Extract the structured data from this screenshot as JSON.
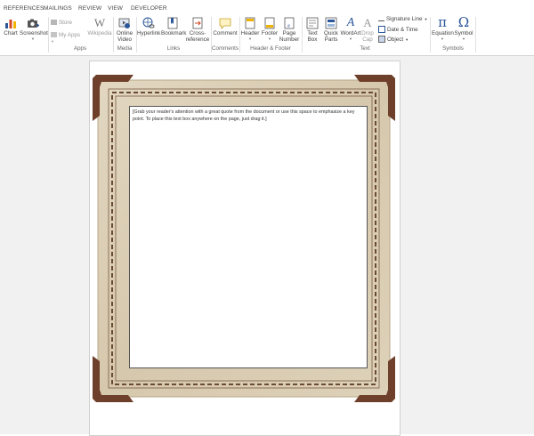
{
  "tabs": [
    "REFERENCES",
    "MAILINGS",
    "REVIEW",
    "VIEW",
    "DEVELOPER"
  ],
  "ribbon": {
    "chart_label": "Chart",
    "screenshot_label": "Screenshot",
    "store_label": "Store",
    "myapps_label": "My Apps",
    "wikipedia_label": "Wikipedia",
    "online_video_label_1": "Online",
    "online_video_label_2": "Video",
    "hyperlink_label": "Hyperlink",
    "bookmark_label": "Bookmark",
    "crossref_label_1": "Cross-",
    "crossref_label_2": "reference",
    "comment_label": "Comment",
    "header_label": "Header",
    "footer_label": "Footer",
    "page_number_label_1": "Page",
    "page_number_label_2": "Number",
    "textbox_label_1": "Text",
    "textbox_label_2": "Box",
    "quickparts_label_1": "Quick",
    "quickparts_label_2": "Parts",
    "wordart_label": "WordArt",
    "dropcap_label_1": "Drop",
    "dropcap_label_2": "Cap",
    "signature_line_label": "Signature Line",
    "date_time_label": "Date & Time",
    "object_label": "Object",
    "equation_label": "Equation",
    "symbol_label": "Symbol",
    "wikipedia_glyph": "W",
    "pi_glyph": "π",
    "omega_glyph": "Ω",
    "wordart_glyph": "A",
    "dropcap_glyph": "A"
  },
  "groups": {
    "apps": "Apps",
    "media": "Media",
    "links": "Links",
    "comments": "Comments",
    "header_footer": "Header & Footer",
    "text": "Text",
    "symbols": "Symbols"
  },
  "document": {
    "textbox_text": "[Grab your reader's attention with a great quote from the document or use this space to emphasize a key point. To place this text box anywhere on the page, just drag it.]"
  },
  "colors": {
    "accent_blue": "#2b579a",
    "frame_paper": "#d8cbb3",
    "frame_corner": "#7a4a32"
  }
}
